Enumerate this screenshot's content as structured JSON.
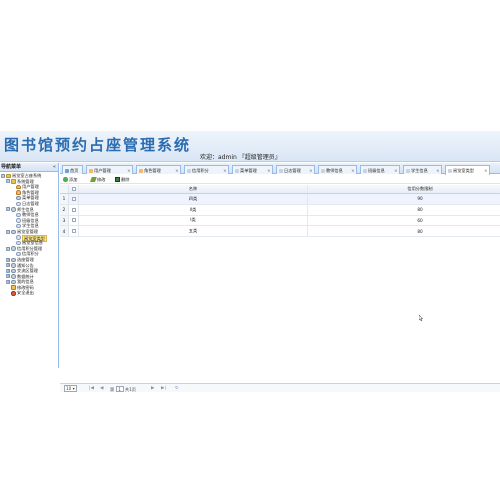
{
  "banner": {
    "title": "图书馆预约占座管理系统",
    "welcome": "欢迎：admin 『超级管理员』"
  },
  "sidebar": {
    "title": "导航菜单",
    "collapse_icon": "«",
    "nodes": [
      {
        "label": "阅览室占座系统",
        "level": 0,
        "icon": "folder",
        "expander": "⊟"
      },
      {
        "label": "系统管理",
        "level": 1,
        "icon": "folder",
        "expander": "⊟"
      },
      {
        "label": "用户管理",
        "level": 2,
        "icon": "user"
      },
      {
        "label": "角色管理",
        "level": 2,
        "icon": "user"
      },
      {
        "label": "菜单管理",
        "level": 2,
        "icon": "gear"
      },
      {
        "label": "日志管理",
        "level": 2,
        "icon": "leaf"
      },
      {
        "label": "师生信息",
        "level": 1,
        "icon": "gear",
        "expander": "⊟"
      },
      {
        "label": "教师信息",
        "level": 2,
        "icon": "leaf"
      },
      {
        "label": "班级信息",
        "level": 2,
        "icon": "leaf"
      },
      {
        "label": "学生信息",
        "level": 2,
        "icon": "leaf"
      },
      {
        "label": "阅览室管理",
        "level": 1,
        "icon": "gear",
        "expander": "⊟"
      },
      {
        "label": "阅览室类型",
        "level": 2,
        "icon": "leaf",
        "selected": true
      },
      {
        "label": "阅览室信息",
        "level": 2,
        "icon": "leaf"
      },
      {
        "label": "信用积分管理",
        "level": 1,
        "icon": "gear",
        "expander": "⊟"
      },
      {
        "label": "信用积分",
        "level": 2,
        "icon": "leaf"
      },
      {
        "label": "选座管理",
        "level": 1,
        "icon": "gear",
        "expander": "⊞"
      },
      {
        "label": "通知公告",
        "level": 1,
        "icon": "gear",
        "expander": "⊞"
      },
      {
        "label": "交流区管理",
        "level": 1,
        "icon": "gear",
        "expander": "⊞"
      },
      {
        "label": "数据统计",
        "level": 1,
        "icon": "gear",
        "expander": "⊞"
      },
      {
        "label": "我的信息",
        "level": 1,
        "icon": "gear",
        "expander": "⊞"
      },
      {
        "label": "修改密码",
        "level": 1,
        "icon": "lock"
      },
      {
        "label": "安全退出",
        "level": 1,
        "icon": "exit"
      }
    ]
  },
  "tabs": [
    {
      "label": "首页",
      "color": "#6a9fd8",
      "closable": false
    },
    {
      "label": "用户管理",
      "color": "#f1b96a",
      "closable": true
    },
    {
      "label": "角色管理",
      "color": "#f1b96a",
      "closable": true
    },
    {
      "label": "信用积分",
      "color": "#c9d3df",
      "closable": true
    },
    {
      "label": "菜单管理",
      "color": "#c9d3df",
      "closable": true
    },
    {
      "label": "日志管理",
      "color": "#c9d3df",
      "closable": true
    },
    {
      "label": "教师信息",
      "color": "#c9d3df",
      "closable": true
    },
    {
      "label": "班级信息",
      "color": "#c9d3df",
      "closable": true
    },
    {
      "label": "学生信息",
      "color": "#c9d3df",
      "closable": true
    },
    {
      "label": "阅览室类型",
      "color": "#c9d3df",
      "closable": true,
      "active": true
    }
  ],
  "tab_close": "×",
  "toolbar": {
    "add_label": "添加",
    "edit_label": "修改",
    "delete_label": "删除"
  },
  "grid": {
    "columns": {
      "name": "名称",
      "limit": "信用分数限制"
    },
    "rows": [
      {
        "num": "1",
        "name": "四类",
        "limit": "90"
      },
      {
        "num": "2",
        "name": "II类",
        "limit": "80"
      },
      {
        "num": "3",
        "name": "I类",
        "limit": "60"
      },
      {
        "num": "4",
        "name": "五类",
        "limit": "80"
      }
    ]
  },
  "pager": {
    "page_size": "10",
    "page_prefix": "第",
    "page_value": "1",
    "page_total": "共1页"
  },
  "colors": {
    "accent": "#2b6cb0",
    "border": "#99bbe8",
    "selected": "#fbe78a"
  }
}
